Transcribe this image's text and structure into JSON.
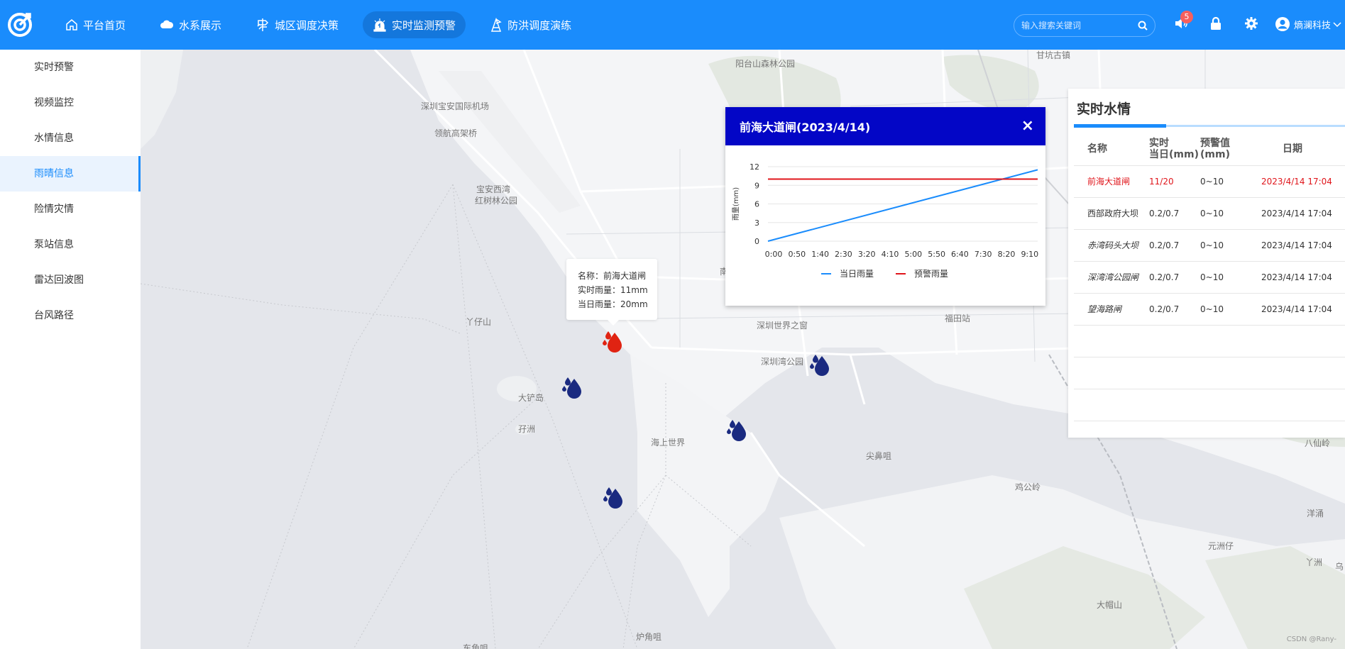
{
  "nav": {
    "items": [
      {
        "label": "平台首页",
        "icon": "home-icon"
      },
      {
        "label": "水系展示",
        "icon": "cloud-icon"
      },
      {
        "label": "城区调度决策",
        "icon": "signpost-icon"
      },
      {
        "label": "实时监测预警",
        "icon": "alarm-light-icon",
        "active": true
      },
      {
        "label": "防洪调度演练",
        "icon": "flag-icon"
      }
    ],
    "search_placeholder": "输入搜索关键词",
    "notification_count": "5",
    "user_name": "熵澜科技"
  },
  "sidebar": {
    "items": [
      {
        "label": "实时预警"
      },
      {
        "label": "视频监控"
      },
      {
        "label": "水情信息"
      },
      {
        "label": "雨晴信息",
        "active": true
      },
      {
        "label": "险情灾情"
      },
      {
        "label": "泵站信息"
      },
      {
        "label": "雷达回波图"
      },
      {
        "label": "台风路径"
      }
    ]
  },
  "map": {
    "places": [
      "阳台山森林公园",
      "甘坑古镇",
      "深圳宝安国际机场",
      "领航高架桥",
      "宝安西湾",
      "红树林公园",
      "丫仔山",
      "深圳世界之窗",
      "福田站",
      "深圳湾公园",
      "大铲岛",
      "孖洲",
      "海上世界",
      "尖鼻咀",
      "鸡公岭",
      "八仙岭",
      "洋涌",
      "元洲仔",
      "丫洲",
      "乌",
      "大帽山",
      "炉角咀",
      "东角咀",
      "南"
    ],
    "tooltip": {
      "name_line": "名称：前海大道闸",
      "realtime_line": "实时雨量：11mm",
      "daily_line": "当日雨量：20mm"
    },
    "credit": "CSDN @Rany-",
    "colors": {
      "alert_drop": "#e02312",
      "normal_drop": "#1a2a80"
    }
  },
  "popup": {
    "title": "前海大道闸(2023/4/14)",
    "close_label": "×"
  },
  "chart_data": {
    "type": "line",
    "x": [
      "0:00",
      "0:50",
      "1:40",
      "2:30",
      "3:20",
      "4:10",
      "5:00",
      "5:50",
      "6:40",
      "7:30",
      "8:20",
      "9:10"
    ],
    "ylabel": "雨量(mm)",
    "ylim": [
      0,
      12
    ],
    "yticks": [
      "0",
      "3",
      "6",
      "9",
      "12"
    ],
    "x_end": 9.5,
    "series": [
      {
        "name": "当日雨量",
        "color": "#1a8cfc",
        "points": [
          [
            0,
            0
          ],
          [
            9.5,
            11.5
          ]
        ]
      },
      {
        "name": "预警雨量",
        "color": "#e0151b",
        "points": [
          [
            0,
            10
          ],
          [
            9.5,
            10
          ]
        ]
      }
    ],
    "legend": "bottom",
    "grid": true
  },
  "panel": {
    "title": "实时水情",
    "headers": {
      "name": "名称",
      "realtime_a": "实时",
      "realtime_b": "当日(mm)",
      "threshold": "预警值(mm)",
      "date": "日期"
    },
    "rows": [
      {
        "name": "前海大道闸",
        "value": "11/20",
        "threshold": "0~10",
        "date": "2023/4/14 17:04"
      },
      {
        "name": "西部政府大坝",
        "value": "0.2/0.7",
        "threshold": "0~10",
        "date": "2023/4/14 17:04"
      },
      {
        "name": "赤湾码头大坝",
        "value": "0.2/0.7",
        "threshold": "0~10",
        "date": "2023/4/14 17:04"
      },
      {
        "name": "深湾湾公园闸",
        "value": "0.2/0.7",
        "threshold": "0~10",
        "date": "2023/4/14 17:04"
      },
      {
        "name": "望海路闸",
        "value": "0.2/0.7",
        "threshold": "0~10",
        "date": "2023/4/14 17:04"
      }
    ]
  }
}
